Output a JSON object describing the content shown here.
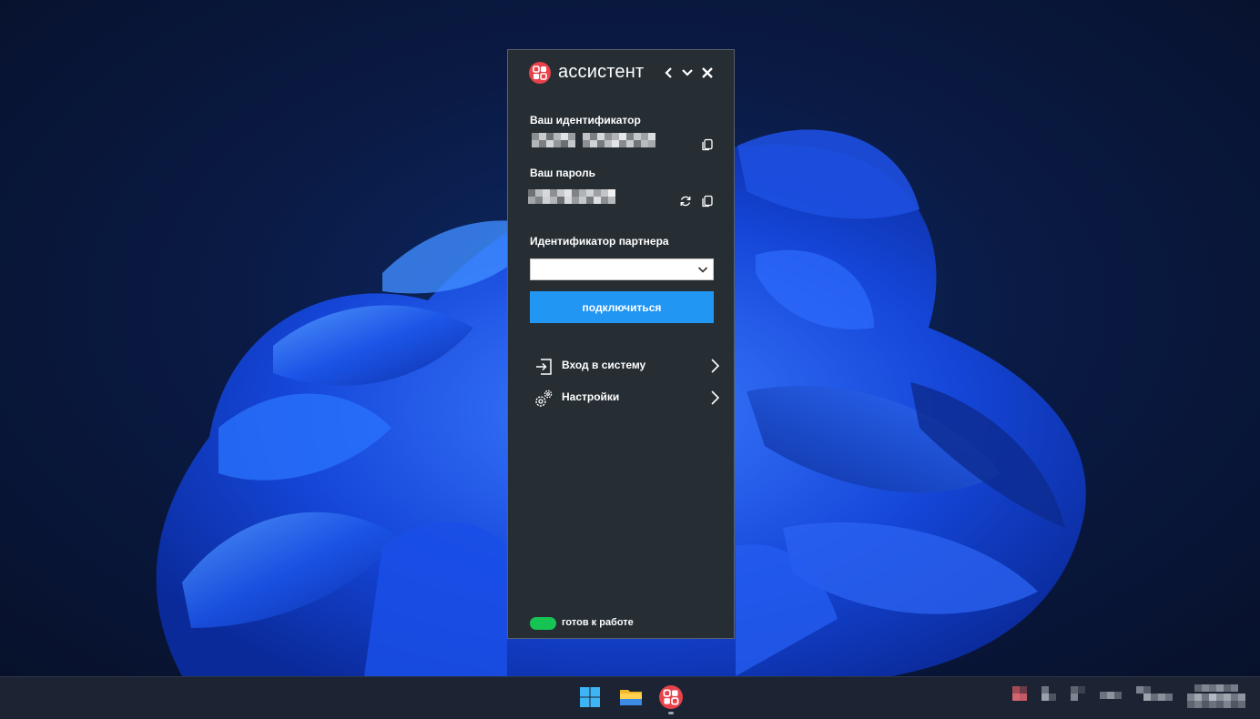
{
  "app": {
    "title": "ассистент",
    "your_id_label": "Ваш идентификатор",
    "your_password_label": "Ваш пароль",
    "partner_id_label": "Идентификатор партнера",
    "partner_id": {
      "value": "",
      "placeholder": ""
    },
    "connect_label": "подключиться",
    "menu": [
      {
        "label": "Вход в систему",
        "icon": "login-icon"
      },
      {
        "label": "Настройки",
        "icon": "settings-gears-icon"
      }
    ],
    "status": {
      "text": "готов к работе",
      "color": "#16c454"
    },
    "accent_color": "#2196f3",
    "brand_color": "#e8424a"
  },
  "taskbar": {
    "items": [
      {
        "name": "windows-start-icon"
      },
      {
        "name": "file-explorer-icon"
      },
      {
        "name": "assistant-app-icon",
        "active": true
      }
    ]
  }
}
